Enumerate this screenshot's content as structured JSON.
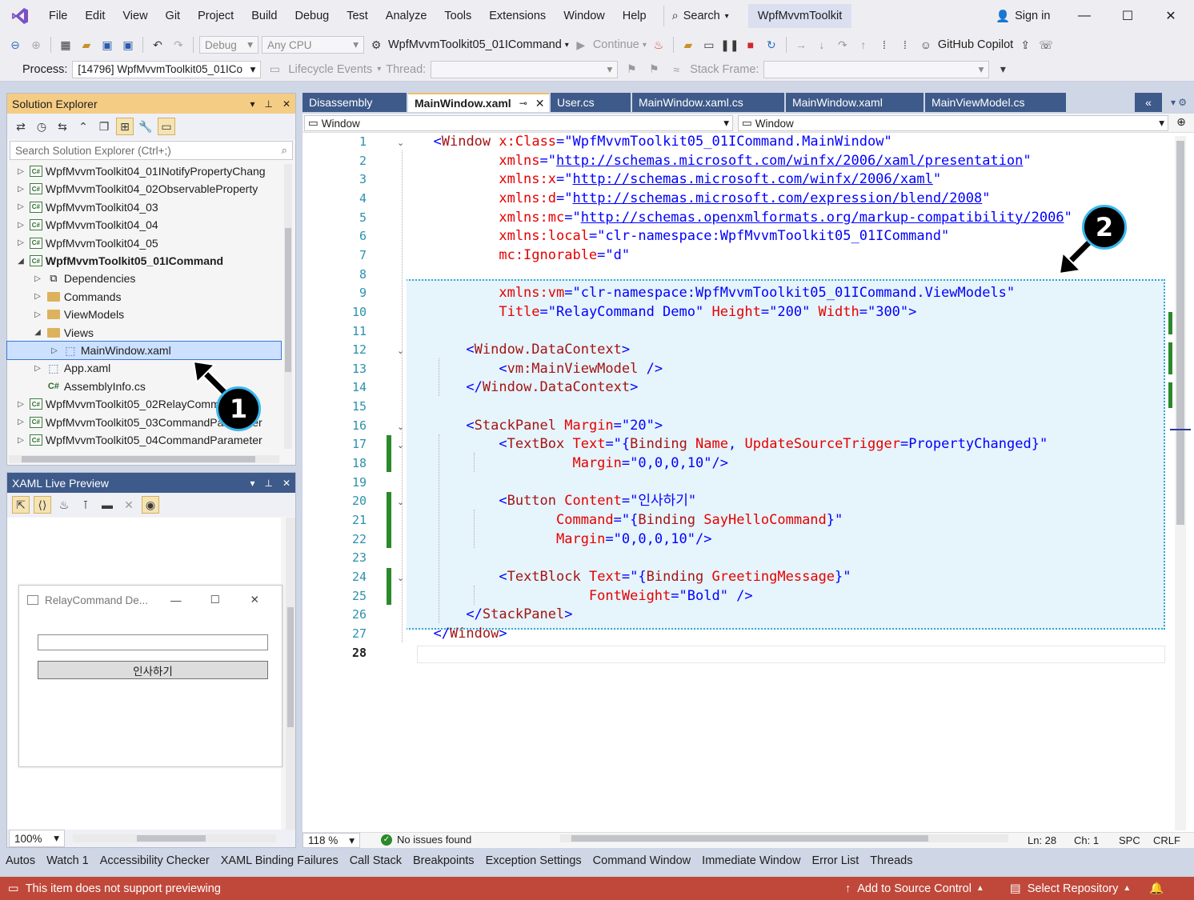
{
  "menubar": {
    "items": [
      "File",
      "Edit",
      "View",
      "Git",
      "Project",
      "Build",
      "Debug",
      "Test",
      "Analyze",
      "Tools",
      "Extensions",
      "Window",
      "Help"
    ],
    "search_label": "Search",
    "solution_name": "WpfMvvmToolkit",
    "sign_in": "Sign in"
  },
  "toolbar": {
    "config": "Debug",
    "platform": "Any CPU",
    "startup_project": "WpfMvvmToolkit05_01ICommand",
    "continue_label": "Continue",
    "copilot_label": "GitHub Copilot",
    "process_label": "Process:",
    "process_value": "[14796] WpfMvvmToolkit05_01ICo",
    "lifecycle_label": "Lifecycle Events",
    "thread_label": "Thread:",
    "stack_frame_label": "Stack Frame:"
  },
  "solution_explorer": {
    "title": "Solution Explorer",
    "search_placeholder": "Search Solution Explorer (Ctrl+;)",
    "items": [
      {
        "label": "WpfMvvmToolkit04_01INotifyPropertyChang",
        "kind": "cs-project",
        "level": 0,
        "arrow": "collapsed"
      },
      {
        "label": "WpfMvvmToolkit04_02ObservableProperty",
        "kind": "cs-project",
        "level": 0,
        "arrow": "collapsed"
      },
      {
        "label": "WpfMvvmToolkit04_03",
        "kind": "cs-project",
        "level": 0,
        "arrow": "collapsed"
      },
      {
        "label": "WpfMvvmToolkit04_04",
        "kind": "cs-project",
        "level": 0,
        "arrow": "collapsed"
      },
      {
        "label": "WpfMvvmToolkit04_05",
        "kind": "cs-project",
        "level": 0,
        "arrow": "collapsed"
      },
      {
        "label": "WpfMvvmToolkit05_01ICommand",
        "kind": "cs-project",
        "level": 0,
        "arrow": "expanded",
        "bold": true
      },
      {
        "label": "Dependencies",
        "kind": "dependencies",
        "level": 1,
        "arrow": "collapsed"
      },
      {
        "label": "Commands",
        "kind": "folder",
        "level": 1,
        "arrow": "collapsed"
      },
      {
        "label": "ViewModels",
        "kind": "folder",
        "level": 1,
        "arrow": "collapsed"
      },
      {
        "label": "Views",
        "kind": "folder",
        "level": 1,
        "arrow": "expanded"
      },
      {
        "label": "MainWindow.xaml",
        "kind": "xaml-file",
        "level": 2,
        "arrow": "collapsed",
        "selected": true
      },
      {
        "label": "App.xaml",
        "kind": "xaml-file",
        "level": 1,
        "arrow": "collapsed"
      },
      {
        "label": "AssemblyInfo.cs",
        "kind": "cs-file",
        "level": 1,
        "arrow": "none"
      },
      {
        "label": "WpfMvvmToolkit05_02RelayCommand",
        "kind": "cs-project",
        "level": 0,
        "arrow": "collapsed"
      },
      {
        "label": "WpfMvvmToolkit05_03CommandParameter",
        "kind": "cs-project",
        "level": 0,
        "arrow": "collapsed"
      },
      {
        "label": "WpfMvvmToolkit05_04CommandParameter",
        "kind": "cs-project",
        "level": 0,
        "arrow": "collapsed"
      }
    ]
  },
  "live_preview": {
    "title": "XAML Live Preview",
    "window_title": "RelayCommand De...",
    "button_label": "인사하기",
    "zoom": "100%"
  },
  "editor": {
    "tabs": [
      {
        "label": "Disassembly",
        "active": false
      },
      {
        "label": "MainWindow.xaml",
        "active": true
      },
      {
        "label": "User.cs",
        "active": false
      },
      {
        "label": "MainWindow.xaml.cs",
        "active": false
      },
      {
        "label": "MainWindow.xaml",
        "active": false
      },
      {
        "label": "MainViewModel.cs",
        "active": false
      }
    ],
    "nav_left": "Window",
    "nav_right": "Window",
    "lines": [
      [
        [
          "  ",
          "txt"
        ],
        [
          "<",
          "pun"
        ],
        [
          "Window ",
          "tag"
        ],
        [
          "x:Class",
          "attr"
        ],
        [
          "=\"WpfMvvmToolkit05_01ICommand.MainWindow\"",
          "val"
        ]
      ],
      [
        [
          "          xmlns",
          "attr"
        ],
        [
          "=\"",
          "val"
        ],
        [
          "http://schemas.microsoft.com/winfx/2006/xaml/presentation",
          "url"
        ],
        [
          "\"",
          "val"
        ]
      ],
      [
        [
          "          xmlns:x",
          "attr"
        ],
        [
          "=\"",
          "val"
        ],
        [
          "http://schemas.microsoft.com/winfx/2006/xaml",
          "url"
        ],
        [
          "\"",
          "val"
        ]
      ],
      [
        [
          "          xmlns:d",
          "attr"
        ],
        [
          "=\"",
          "val"
        ],
        [
          "http://schemas.microsoft.com/expression/blend/2008",
          "url"
        ],
        [
          "\"",
          "val"
        ]
      ],
      [
        [
          "          xmlns:mc",
          "attr"
        ],
        [
          "=\"",
          "val"
        ],
        [
          "http://schemas.openxmlformats.org/markup-compatibility/2006",
          "url"
        ],
        [
          "\"",
          "val"
        ]
      ],
      [
        [
          "          xmlns:local",
          "attr"
        ],
        [
          "=\"clr-namespace:WpfMvvmToolkit05_01ICommand\"",
          "val"
        ]
      ],
      [
        [
          "          mc:Ignorable",
          "attr"
        ],
        [
          "=\"d\"",
          "val"
        ]
      ],
      [
        [
          "",
          "txt"
        ]
      ],
      [
        [
          "          xmlns:vm",
          "attr"
        ],
        [
          "=\"clr-namespace:WpfMvvmToolkit05_01ICommand.ViewModels\"",
          "val"
        ]
      ],
      [
        [
          "          Title",
          "attr"
        ],
        [
          "=\"RelayCommand Demo\" ",
          "val"
        ],
        [
          "Height",
          "attr"
        ],
        [
          "=\"200\" ",
          "val"
        ],
        [
          "Width",
          "attr"
        ],
        [
          "=\"300\"",
          "val"
        ],
        [
          ">",
          "pun"
        ]
      ],
      [
        [
          "",
          "txt"
        ]
      ],
      [
        [
          "      <",
          "pun"
        ],
        [
          "Window.DataContext",
          "tag"
        ],
        [
          ">",
          "pun"
        ]
      ],
      [
        [
          "          <",
          "pun"
        ],
        [
          "vm:MainViewModel ",
          "tag"
        ],
        [
          "/>",
          "pun"
        ]
      ],
      [
        [
          "      </",
          "pun"
        ],
        [
          "Window.DataContext",
          "tag"
        ],
        [
          ">",
          "pun"
        ]
      ],
      [
        [
          "",
          "txt"
        ]
      ],
      [
        [
          "      <",
          "pun"
        ],
        [
          "StackPanel ",
          "tag"
        ],
        [
          "Margin",
          "attr"
        ],
        [
          "=\"20\"",
          "val"
        ],
        [
          ">",
          "pun"
        ]
      ],
      [
        [
          "          <",
          "pun"
        ],
        [
          "TextBox ",
          "tag"
        ],
        [
          "Text",
          "attr"
        ],
        [
          "=\"{",
          "val"
        ],
        [
          "Binding ",
          "tag"
        ],
        [
          "Name",
          "attr"
        ],
        [
          ", ",
          "val"
        ],
        [
          "UpdateSourceTrigger",
          "attr"
        ],
        [
          "=",
          "val"
        ],
        [
          "PropertyChanged",
          "val"
        ],
        [
          "}\"",
          "val"
        ]
      ],
      [
        [
          "                   Margin",
          "attr"
        ],
        [
          "=\"0,0,0,10\"",
          "val"
        ],
        [
          "/>",
          "pun"
        ]
      ],
      [
        [
          "",
          "txt"
        ]
      ],
      [
        [
          "          <",
          "pun"
        ],
        [
          "Button ",
          "tag"
        ],
        [
          "Content",
          "attr"
        ],
        [
          "=\"인사하기\"",
          "val"
        ]
      ],
      [
        [
          "                 Command",
          "attr"
        ],
        [
          "=\"{",
          "val"
        ],
        [
          "Binding ",
          "tag"
        ],
        [
          "SayHelloCommand",
          "attr"
        ],
        [
          "}\"",
          "val"
        ]
      ],
      [
        [
          "                 Margin",
          "attr"
        ],
        [
          "=\"0,0,0,10\"",
          "val"
        ],
        [
          "/>",
          "pun"
        ]
      ],
      [
        [
          "",
          "txt"
        ]
      ],
      [
        [
          "          <",
          "pun"
        ],
        [
          "TextBlock ",
          "tag"
        ],
        [
          "Text",
          "attr"
        ],
        [
          "=\"{",
          "val"
        ],
        [
          "Binding ",
          "tag"
        ],
        [
          "GreetingMessage",
          "attr"
        ],
        [
          "}\"",
          "val"
        ]
      ],
      [
        [
          "                     FontWeight",
          "attr"
        ],
        [
          "=\"Bold\" ",
          "val"
        ],
        [
          "/>",
          "pun"
        ]
      ],
      [
        [
          "      </",
          "pun"
        ],
        [
          "StackPanel",
          "tag"
        ],
        [
          ">",
          "pun"
        ]
      ],
      [
        [
          "  </",
          "pun"
        ],
        [
          "Window",
          "tag"
        ],
        [
          ">",
          "pun"
        ]
      ],
      [
        [
          "",
          "txt"
        ]
      ]
    ],
    "zoom": "118 %",
    "issues": "No issues found",
    "ln": "Ln: 28",
    "ch": "Ch: 1",
    "spc": "SPC",
    "crlf": "CRLF"
  },
  "bottom_tabs": [
    "Autos",
    "Watch 1",
    "Accessibility Checker",
    "XAML Binding Failures",
    "Call Stack",
    "Breakpoints",
    "Exception Settings",
    "Command Window",
    "Immediate Window",
    "Error List",
    "Threads"
  ],
  "statusbar": {
    "message": "This item does not support previewing",
    "add_source": "Add to Source Control",
    "select_repo": "Select Repository"
  },
  "callouts": [
    "1",
    "2"
  ],
  "colors": {
    "accent": "#3e5a8a",
    "statusbar": "#c0483a",
    "highlight": "#2fa6d3"
  }
}
